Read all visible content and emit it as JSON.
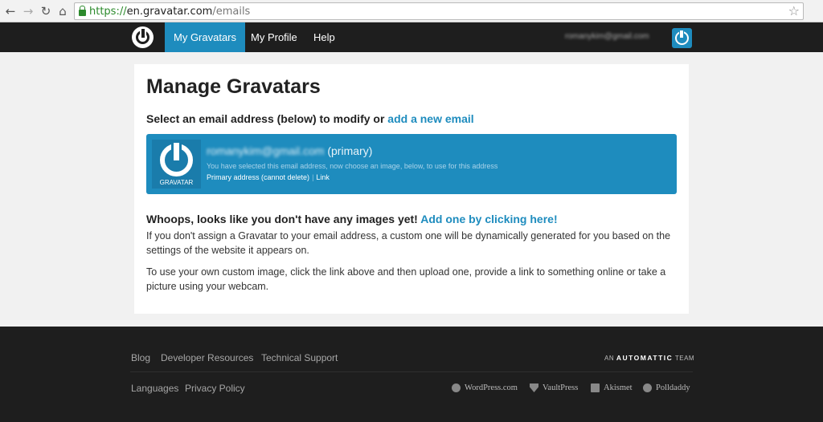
{
  "browser": {
    "url_scheme": "https://",
    "url_host": "en.gravatar.com",
    "url_path": "/emails"
  },
  "nav": {
    "items": [
      {
        "label": "My Gravatars",
        "active": true
      },
      {
        "label": "My Profile",
        "active": false
      },
      {
        "label": "Help",
        "active": false
      }
    ],
    "user_email": "romanykim@gmail.com"
  },
  "main": {
    "title": "Manage Gravatars",
    "select_prompt": "Select an email address (below) to modify or",
    "add_email_link": "add a new email",
    "email_card": {
      "thumb_label": "GRAVATAR",
      "email": "romanykim@gmail.com",
      "primary_tag": "(primary)",
      "hint": "You have selected this email address, now choose an image, below, to use for this address",
      "primary_note": "Primary address (cannot delete)",
      "link_label": "Link"
    },
    "whoops_text": "Whoops, looks like you don't have any images yet!",
    "add_image_link": "Add one by clicking here!",
    "paragraph1": "If you don't assign a Gravatar to your email address, a custom one will be dynamically generated for you based on the settings of the website it appears on.",
    "paragraph2": "To use your own custom image, click the link above and then upload one, provide a link to something online or take a picture using your webcam."
  },
  "footer": {
    "links_top": [
      "Blog",
      "Developer Resources",
      "Technical Support"
    ],
    "links_bottom": [
      "Languages",
      "Privacy Policy"
    ],
    "automattic_prefix": "AN",
    "automattic_name": "AUTOMATTIC",
    "automattic_suffix": "TEAM",
    "partners": [
      "WordPress.com",
      "VaultPress",
      "Akismet",
      "Polldaddy"
    ]
  },
  "colors": {
    "accent": "#1e8cbe",
    "header_bg": "#1e1e1e",
    "page_bg": "#f1f1f1"
  }
}
